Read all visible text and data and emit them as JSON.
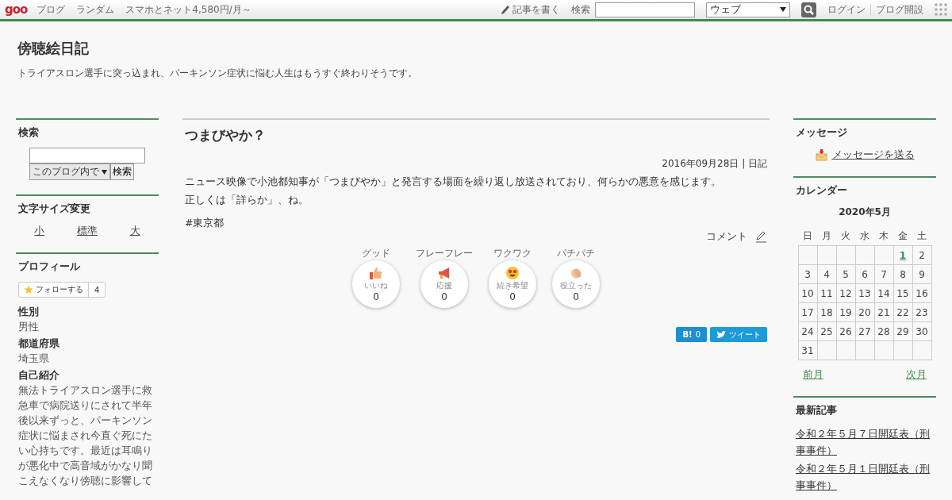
{
  "topbar": {
    "logo": "goo",
    "links": [
      "ブログ",
      "ランダム",
      "スマホとネット4,580円/月～"
    ],
    "write": "記事を書く",
    "search_label": "検索",
    "search_scope": "ウェブ",
    "login": "ログイン",
    "open_blog": "ブログ開設"
  },
  "header": {
    "title": "傍聴絵日記",
    "tagline": "トライアスロン選手に突っ込まれ、パーキンソン症状に悩む人生はもうすぐ終わりそうです。"
  },
  "left": {
    "search": {
      "heading": "検索",
      "scope": "このブログ内で",
      "button": "検索"
    },
    "font_size": {
      "heading": "文字サイズ変更",
      "options": [
        "小",
        "標準",
        "大"
      ]
    },
    "profile": {
      "heading": "プロフィール",
      "follow": "フォローする",
      "followers": "4",
      "fields": [
        {
          "label": "性別",
          "value": "男性"
        },
        {
          "label": "都道府県",
          "value": "埼玉県"
        },
        {
          "label": "自己紹介",
          "value": "無法トライアスロン選手に救急車で病院送りにされて半年後以来ずっと、パーキンソン症状に悩まされ今直ぐ死にたい心持ちです。最近は耳鳴りが悪化中で高音域がかなり聞こえなくなり傍聴に影響して"
        }
      ]
    }
  },
  "article": {
    "title": "つまびやか？",
    "meta": "2016年09月28日 | 日記",
    "body": [
      "ニュース映像で小池都知事が「つまびやか」と発言する場面を繰り返し放送されており、何らかの悪意を感じます。",
      "正しくは「詳らか」、ね。"
    ],
    "tag": "#東京都",
    "comment": "コメント",
    "reactions": [
      {
        "kind": "thumb",
        "caption": "グッド",
        "label": "いいね",
        "count": "0"
      },
      {
        "kind": "megaphone",
        "caption": "フレーフレー",
        "label": "応援",
        "count": "0"
      },
      {
        "kind": "hearteyes",
        "caption": "ワクワク",
        "label": "続き希望",
        "count": "0"
      },
      {
        "kind": "clap",
        "caption": "パチパチ",
        "label": "役立った",
        "count": "0"
      }
    ],
    "hatena": {
      "mark": "B!",
      "count": "0"
    },
    "tweet": "ツイート"
  },
  "right": {
    "message": {
      "heading": "メッセージ",
      "link": "メッセージを送る"
    },
    "calendar": {
      "heading": "カレンダー",
      "month": "2020年5月",
      "weekdays": [
        "日",
        "月",
        "火",
        "水",
        "木",
        "金",
        "土"
      ],
      "weeks": [
        {
          "kind": "first",
          "days": [
            {
              "day": "1",
              "link": true
            },
            {
              "day": "2",
              "link": false
            }
          ]
        },
        {
          "kind": "full",
          "days": [
            {
              "day": "3",
              "link": false
            },
            {
              "day": "4",
              "link": false
            },
            {
              "day": "5",
              "link": false
            },
            {
              "day": "6",
              "link": false
            },
            {
              "day": "7",
              "link": false
            },
            {
              "day": "8",
              "link": false
            },
            {
              "day": "9",
              "link": false
            }
          ]
        },
        {
          "kind": "full",
          "days": [
            {
              "day": "10",
              "link": false
            },
            {
              "day": "11",
              "link": false
            },
            {
              "day": "12",
              "link": false
            },
            {
              "day": "13",
              "link": false
            },
            {
              "day": "14",
              "link": false
            },
            {
              "day": "15",
              "link": false
            },
            {
              "day": "16",
              "link": false
            }
          ]
        },
        {
          "kind": "full",
          "days": [
            {
              "day": "17",
              "link": false
            },
            {
              "day": "18",
              "link": false
            },
            {
              "day": "19",
              "link": false
            },
            {
              "day": "20",
              "link": false
            },
            {
              "day": "21",
              "link": false
            },
            {
              "day": "22",
              "link": false
            },
            {
              "day": "23",
              "link": false
            }
          ]
        },
        {
          "kind": "full",
          "days": [
            {
              "day": "24",
              "link": false
            },
            {
              "day": "25",
              "link": false
            },
            {
              "day": "26",
              "link": false
            },
            {
              "day": "27",
              "link": false
            },
            {
              "day": "28",
              "link": false
            },
            {
              "day": "29",
              "link": false
            },
            {
              "day": "30",
              "link": false
            }
          ]
        },
        {
          "kind": "last",
          "days": [
            {
              "day": "31",
              "link": false
            }
          ]
        }
      ],
      "prev": "前月",
      "next": "次月"
    },
    "recent": {
      "heading": "最新記事",
      "items": [
        "令和２年５月７日開廷表（刑事事件）",
        "令和２年５月１日開廷表（刑事事件）"
      ]
    }
  }
}
